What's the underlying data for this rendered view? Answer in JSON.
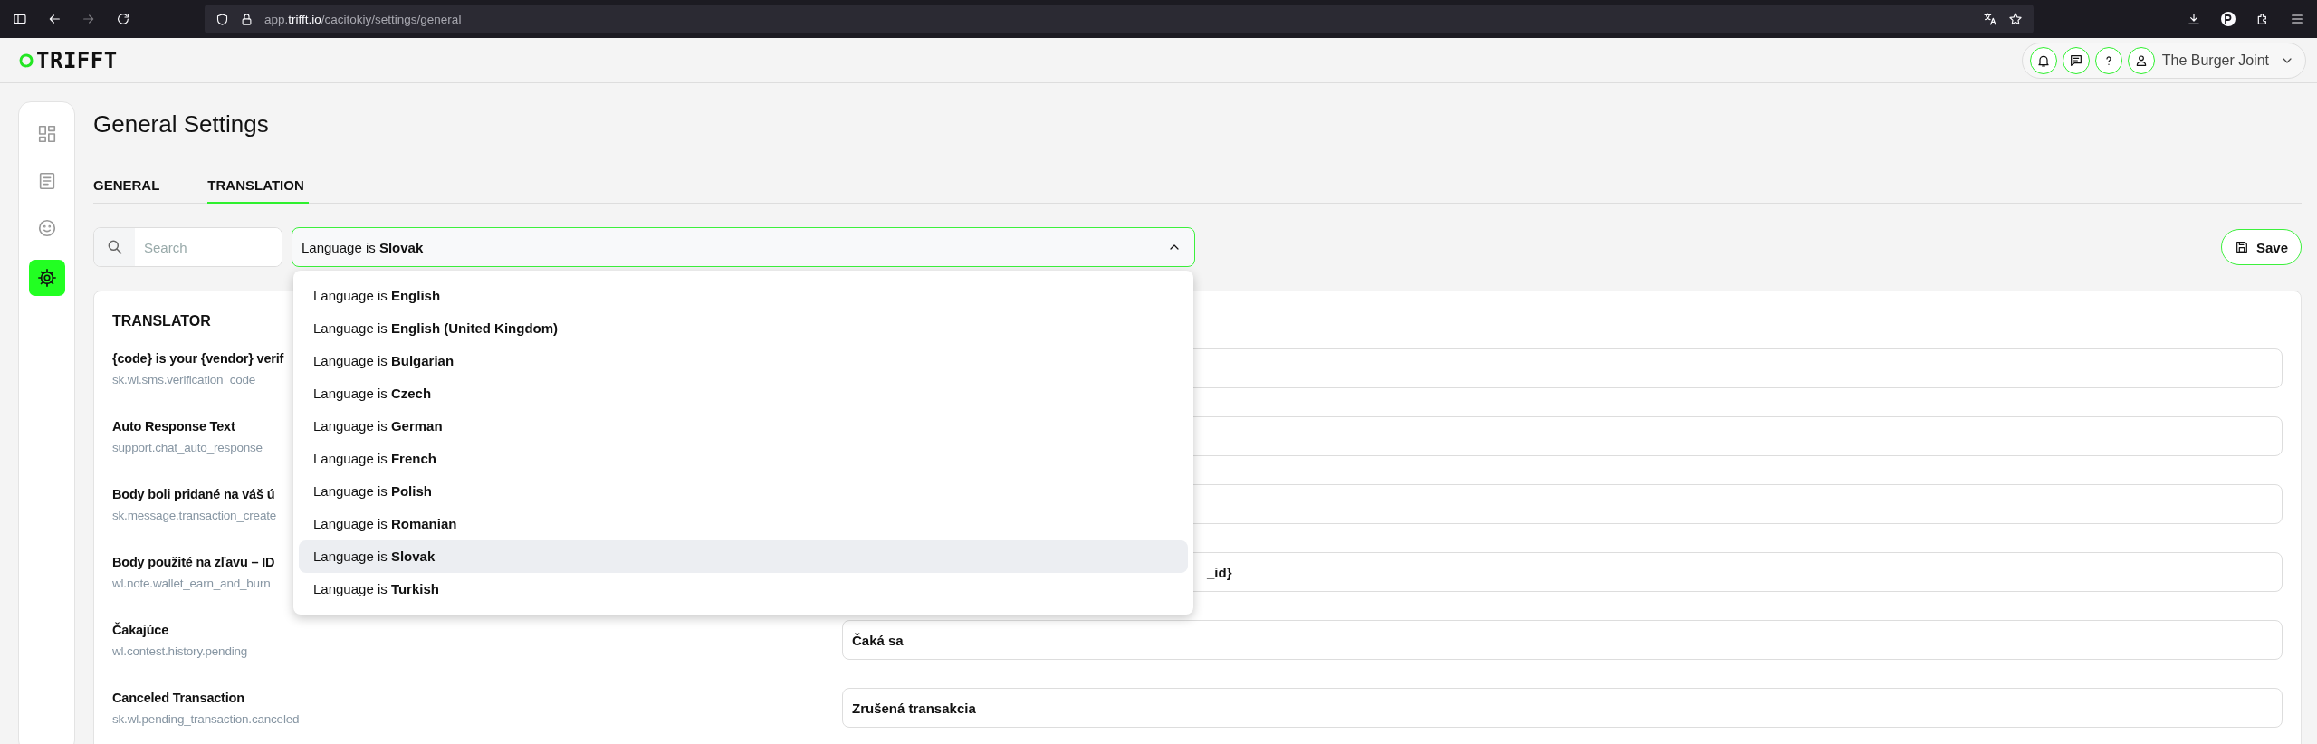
{
  "browser": {
    "url": "app.**trifft.io**/cacitokiy/settings/general"
  },
  "header": {
    "logo": "TRIFFT",
    "account": "The Burger Joint"
  },
  "sidebar": {
    "items": [
      {
        "selected": false
      },
      {
        "selected": false
      },
      {
        "selected": false
      },
      {
        "selected": true
      }
    ]
  },
  "page": {
    "title": "General Settings"
  },
  "tabs": [
    {
      "label": "GENERAL",
      "selected": false
    },
    {
      "label": "TRANSLATION",
      "selected": true
    }
  ],
  "search": {
    "placeholder": "Search"
  },
  "language_filter": {
    "value": "Language is **Slovak**",
    "expanded": true,
    "options": [
      {
        "label": "Language is **English**",
        "selected": false
      },
      {
        "label": "Language is **English (United Kingdom)**",
        "selected": false
      },
      {
        "label": "Language is **Bulgarian**",
        "selected": false
      },
      {
        "label": "Language is **Czech**",
        "selected": false
      },
      {
        "label": "Language is **German**",
        "selected": false
      },
      {
        "label": "Language is **French**",
        "selected": false
      },
      {
        "label": "Language is **Polish**",
        "selected": false
      },
      {
        "label": "Language is **Romanian**",
        "selected": false
      },
      {
        "label": "Language is **Slovak**",
        "selected": true
      },
      {
        "label": "Language is **Turkish**",
        "selected": false
      }
    ]
  },
  "save_button": {
    "label": "Save"
  },
  "translator": {
    "title": "TRANSLATOR",
    "rows": [
      {
        "label": "{code} is your {vendor} verif",
        "key": "sk.wl.sms.verification_code"
      },
      {
        "label": "Auto Response Text",
        "key": "support.chat_auto_response"
      },
      {
        "label": "Body boli pridané na váš ú",
        "key": "sk.message.transaction_create"
      },
      {
        "label": "Body použité na zľavu – ID",
        "key": "wl.note.wallet_earn_and_burn",
        "value": "_id}",
        "covered": true
      },
      {
        "label": "Čakajúce",
        "key": "wl.contest.history.pending",
        "value": "Čaká sa",
        "covered": false
      },
      {
        "label": "Canceled Transaction",
        "key": "sk.wl.pending_transaction.canceled",
        "value": "Zrušená transakcia",
        "covered": false
      }
    ]
  }
}
